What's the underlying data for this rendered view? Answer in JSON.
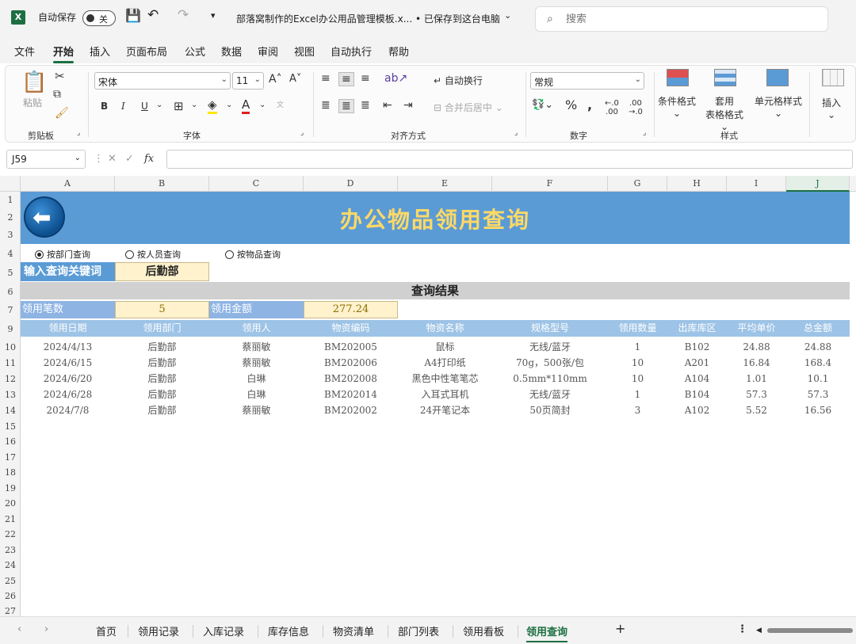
{
  "titlebar": {
    "app_icon": "X",
    "autosave_label": "自动保存",
    "autosave_state": "关",
    "doc_title": "部落窝制作的Excel办公用品管理模板.x... • 已保存到这台电脑",
    "search_placeholder": "搜索"
  },
  "menu": [
    "文件",
    "开始",
    "插入",
    "页面布局",
    "公式",
    "数据",
    "审阅",
    "视图",
    "自动执行",
    "帮助"
  ],
  "ribbon": {
    "paste": "粘贴",
    "clipboard": "剪贴板",
    "font_name": "宋体",
    "font_size": "11",
    "font_group": "字体",
    "bold": "B",
    "italic": "I",
    "underline": "U",
    "wrap": "自动换行",
    "merge": "合并后居中",
    "align_group": "对齐方式",
    "number_format": "常规",
    "number_group": "数字",
    "cond_format": "条件格式",
    "table_format_1": "套用",
    "table_format_2": "表格格式",
    "cell_style": "单元格样式",
    "style_group": "样式",
    "insert": "插入"
  },
  "formula_bar": {
    "name_box": "J59",
    "fx": "fx"
  },
  "columns": [
    "A",
    "B",
    "C",
    "D",
    "E",
    "F",
    "G",
    "H",
    "I",
    "J"
  ],
  "rows": [
    "1",
    "2",
    "3",
    "4",
    "5",
    "6",
    "7",
    "9",
    "10",
    "11",
    "12",
    "13",
    "14",
    "15",
    "16",
    "17",
    "18",
    "19",
    "20",
    "21",
    "22",
    "23",
    "24",
    "25",
    "26",
    "27"
  ],
  "sheet": {
    "title": "办公物品领用查询",
    "radios": [
      {
        "label": "按部门查询",
        "selected": true
      },
      {
        "label": "按人员查询",
        "selected": false
      },
      {
        "label": "按物品查询",
        "selected": false
      }
    ],
    "keyword_label": "输入查询关键词",
    "keyword_value": "后勤部",
    "result_title": "查询结果",
    "count_label": "领用笔数",
    "count_value": "5",
    "amount_label": "领用金额",
    "amount_value": "277.24",
    "headers": [
      "领用日期",
      "领用部门",
      "领用人",
      "物资编码",
      "物资名称",
      "规格型号",
      "领用数量",
      "出库库区",
      "平均单价",
      "总金额"
    ],
    "records": [
      [
        "2024/4/13",
        "后勤部",
        "蔡丽敏",
        "BM202005",
        "鼠标",
        "无线/蓝牙",
        "1",
        "B102",
        "24.88",
        "24.88"
      ],
      [
        "2024/6/15",
        "后勤部",
        "蔡丽敏",
        "BM202006",
        "A4打印纸",
        "70g，500张/包",
        "10",
        "A201",
        "16.84",
        "168.4"
      ],
      [
        "2024/6/20",
        "后勤部",
        "白琳",
        "BM202008",
        "黑色中性笔笔芯",
        "0.5mm*110mm",
        "10",
        "A104",
        "1.01",
        "10.1"
      ],
      [
        "2024/6/28",
        "后勤部",
        "白琳",
        "BM202014",
        "入耳式耳机",
        "无线/蓝牙",
        "1",
        "B104",
        "57.3",
        "57.3"
      ],
      [
        "2024/7/8",
        "后勤部",
        "蔡丽敏",
        "BM202002",
        "24开笔记本",
        "50页简封",
        "3",
        "A102",
        "5.52",
        "16.56"
      ]
    ]
  },
  "tabs": [
    "首页",
    "领用记录",
    "入库记录",
    "库存信息",
    "物资清单",
    "部门列表",
    "领用看板",
    "领用查询"
  ],
  "active_tab": "领用查询",
  "add_sheet": "+",
  "colors": {
    "banner": "#5b9bd5",
    "title_yellow": "#ffd966",
    "excel_green": "#1d6f42"
  }
}
